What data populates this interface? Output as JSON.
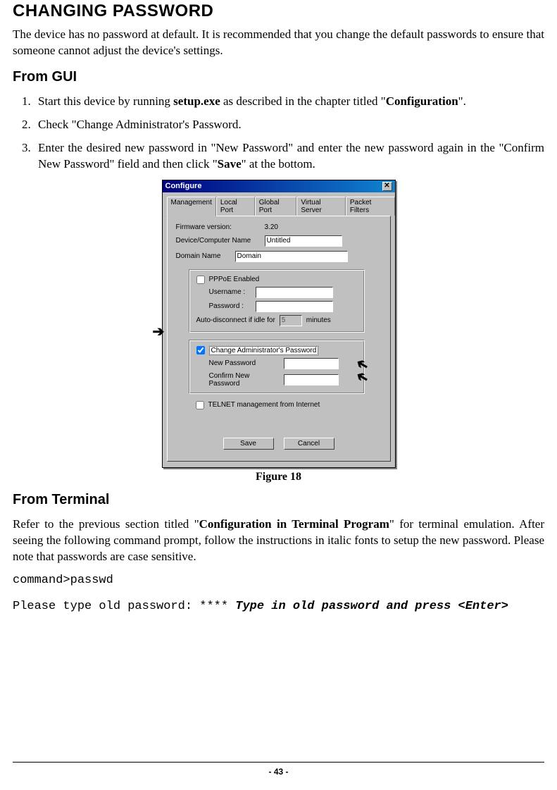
{
  "heading_main": "CHANGING PASSWORD",
  "intro": "The device has no password at default. It is recommended that you change the default passwords to ensure that someone cannot adjust the device's settings.",
  "heading_from_gui": "From GUI",
  "steps": {
    "s1_pre": "Start this device by running ",
    "s1_bold1": "setup.exe",
    "s1_mid": " as described in the chapter titled \"",
    "s1_bold2": "Configuration",
    "s1_post": "\".",
    "s2": "Check \"Change Administrator's Password.",
    "s3_pre": "Enter the desired new password in \"New Password\" and enter the new password again in the \"Confirm New Password\" field and then click \"",
    "s3_bold": "Save",
    "s3_post": "\" at the bottom."
  },
  "dialog": {
    "title": "Configure",
    "tabs": [
      "Management",
      "Local Port",
      "Global Port",
      "Virtual Server",
      "Packet Filters"
    ],
    "firmware_label": "Firmware version:",
    "firmware_value": "3.20",
    "devname_label": "Device/Computer Name",
    "devname_value": "Untitled",
    "domain_label": "Domain Name",
    "domain_value": "Domain",
    "pppoe_label": "PPPoE Enabled",
    "username_label": "Username :",
    "username_value": "",
    "password_label": "Password :",
    "password_value": "",
    "autodisc_pre": "Auto-disconnect if idle for",
    "autodisc_value": "5",
    "autodisc_post": "minutes",
    "change_pw_label": "Change Administrator's Password",
    "newpw_label": "New Password",
    "newpw_value": "",
    "confirmpw_label": "Confirm New Password",
    "confirmpw_value": "",
    "telnet_label": "TELNET management from Internet",
    "save_btn": "Save",
    "cancel_btn": "Cancel"
  },
  "figure_caption": "Figure 18",
  "heading_from_terminal": "From Terminal",
  "terminal_para_pre": "Refer to the previous section titled \"",
  "terminal_para_bold": "Configuration in Terminal Program",
  "terminal_para_post": "\" for terminal emulation. After seeing the following command prompt, follow the instructions in italic fonts to setup the new password.  Please note that passwords are case sensitive.",
  "cmd1": "command>passwd",
  "cmd2_plain": "Please type old password: **** ",
  "cmd2_italic": "Type in old password and press <Enter>",
  "page_number": "- 43 -"
}
